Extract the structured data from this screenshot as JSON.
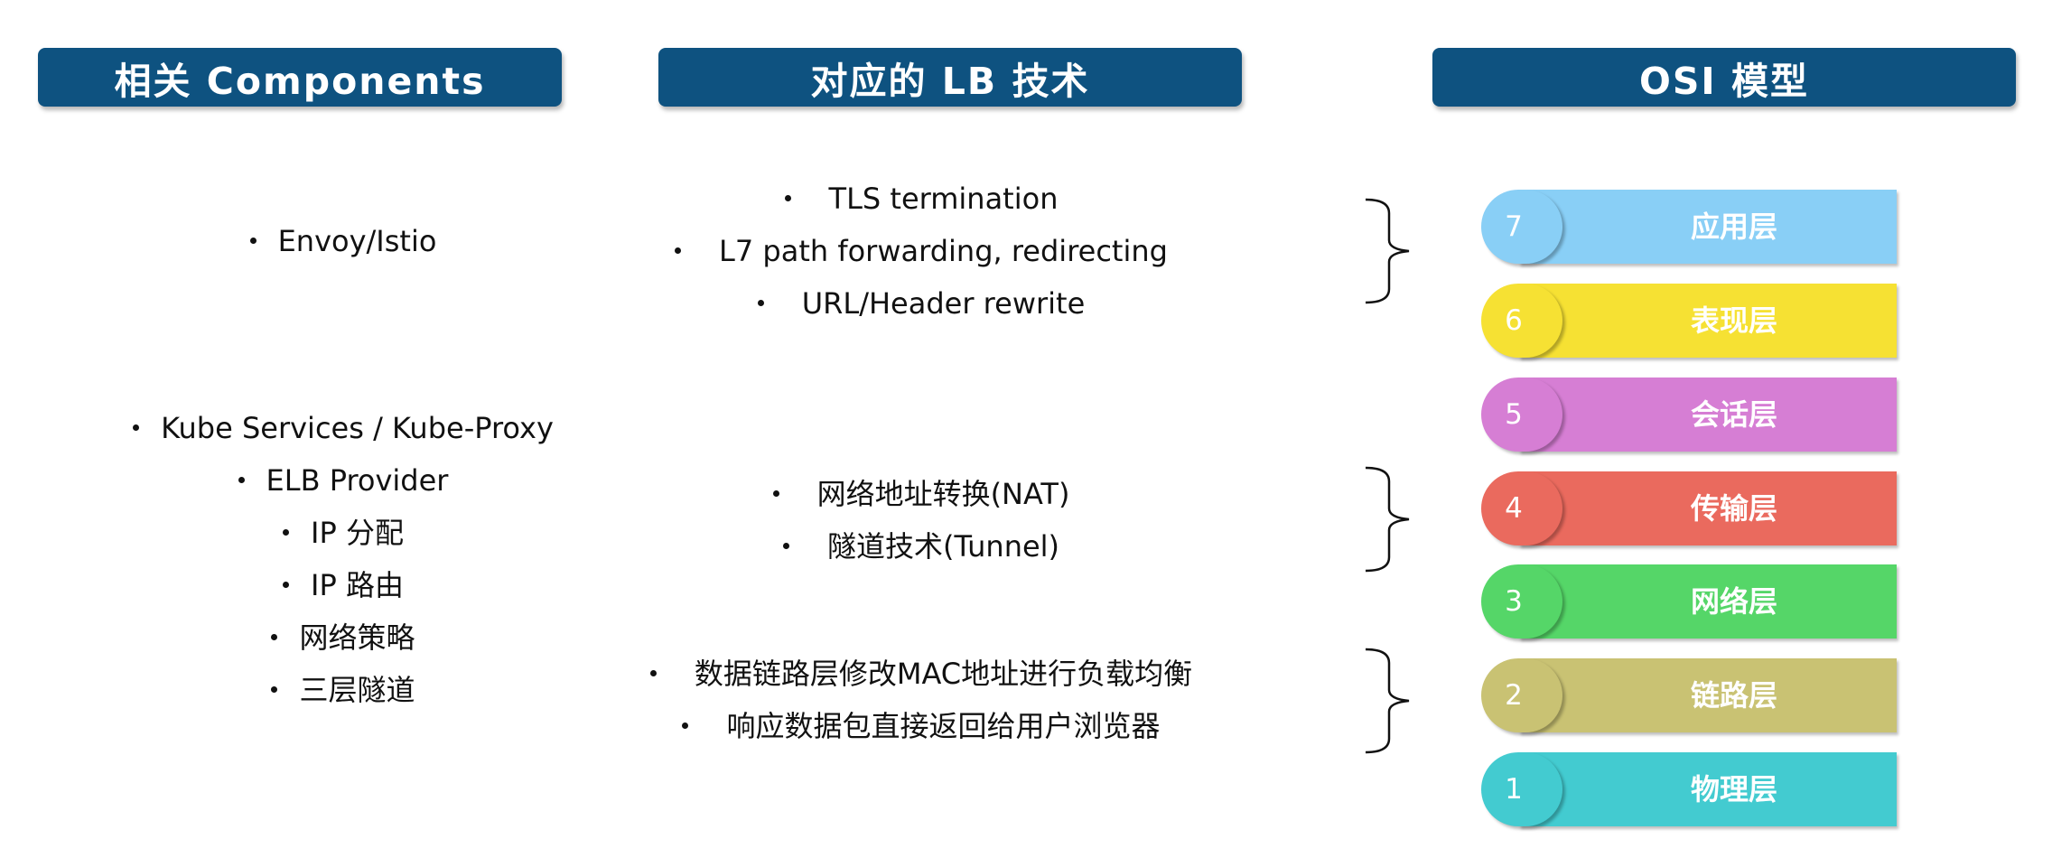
{
  "headers": {
    "components": "相关 Components",
    "lb": "对应的 LB 技术",
    "osi": "OSI 模型"
  },
  "components": {
    "group1": [
      "Envoy/Istio"
    ],
    "group2": [
      "Kube Services / Kube-Proxy",
      "ELB Provider",
      "IP 分配",
      "IP 路由",
      "网络策略",
      "三层隧道"
    ]
  },
  "lb": {
    "group1": [
      "TLS termination",
      "L7 path forwarding, redirecting",
      "URL/Header rewrite"
    ],
    "group2": [
      "网络地址转换(NAT)",
      "隧道技术(Tunnel)"
    ],
    "group3": [
      "数据链路层修改MAC地址进行负载均衡",
      "响应数据包直接返回给用户浏览器"
    ]
  },
  "osi_layers": [
    {
      "number": "7",
      "name": "应用层",
      "color": "#89cff6"
    },
    {
      "number": "6",
      "name": "表现层",
      "color": "#f6e133"
    },
    {
      "number": "5",
      "name": "会话层",
      "color": "#d67ed4"
    },
    {
      "number": "4",
      "name": "传输层",
      "color": "#ea6a5e"
    },
    {
      "number": "3",
      "name": "网络层",
      "color": "#55d668"
    },
    {
      "number": "2",
      "name": "链路层",
      "color": "#c9c273"
    },
    {
      "number": "1",
      "name": "物理层",
      "color": "#43cbd0"
    }
  ],
  "colors": {
    "header_bg": "#0e5280",
    "header_text": "#ffffff",
    "body_text": "#111111"
  }
}
